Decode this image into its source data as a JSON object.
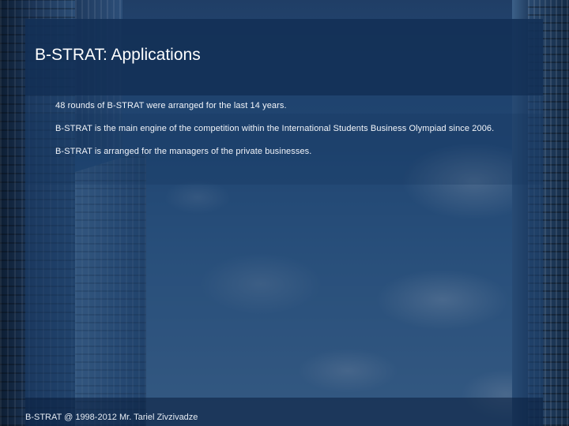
{
  "slide": {
    "title": "B-STRAT: Applications",
    "bullets": [
      "48 rounds of B-STRAT were arranged for the last 14 years.",
      "B-STRAT is the main engine of the competition within the International Students Business Olympiad since 2006.",
      "B-STRAT is arranged for the managers of the private businesses."
    ],
    "footer": "B-STRAT @ 1998-2012 Mr. Tariel Zivzivadze"
  },
  "colors": {
    "panel": "#1c3e68",
    "title_bar": "#102c52",
    "text": "#ffffff"
  }
}
